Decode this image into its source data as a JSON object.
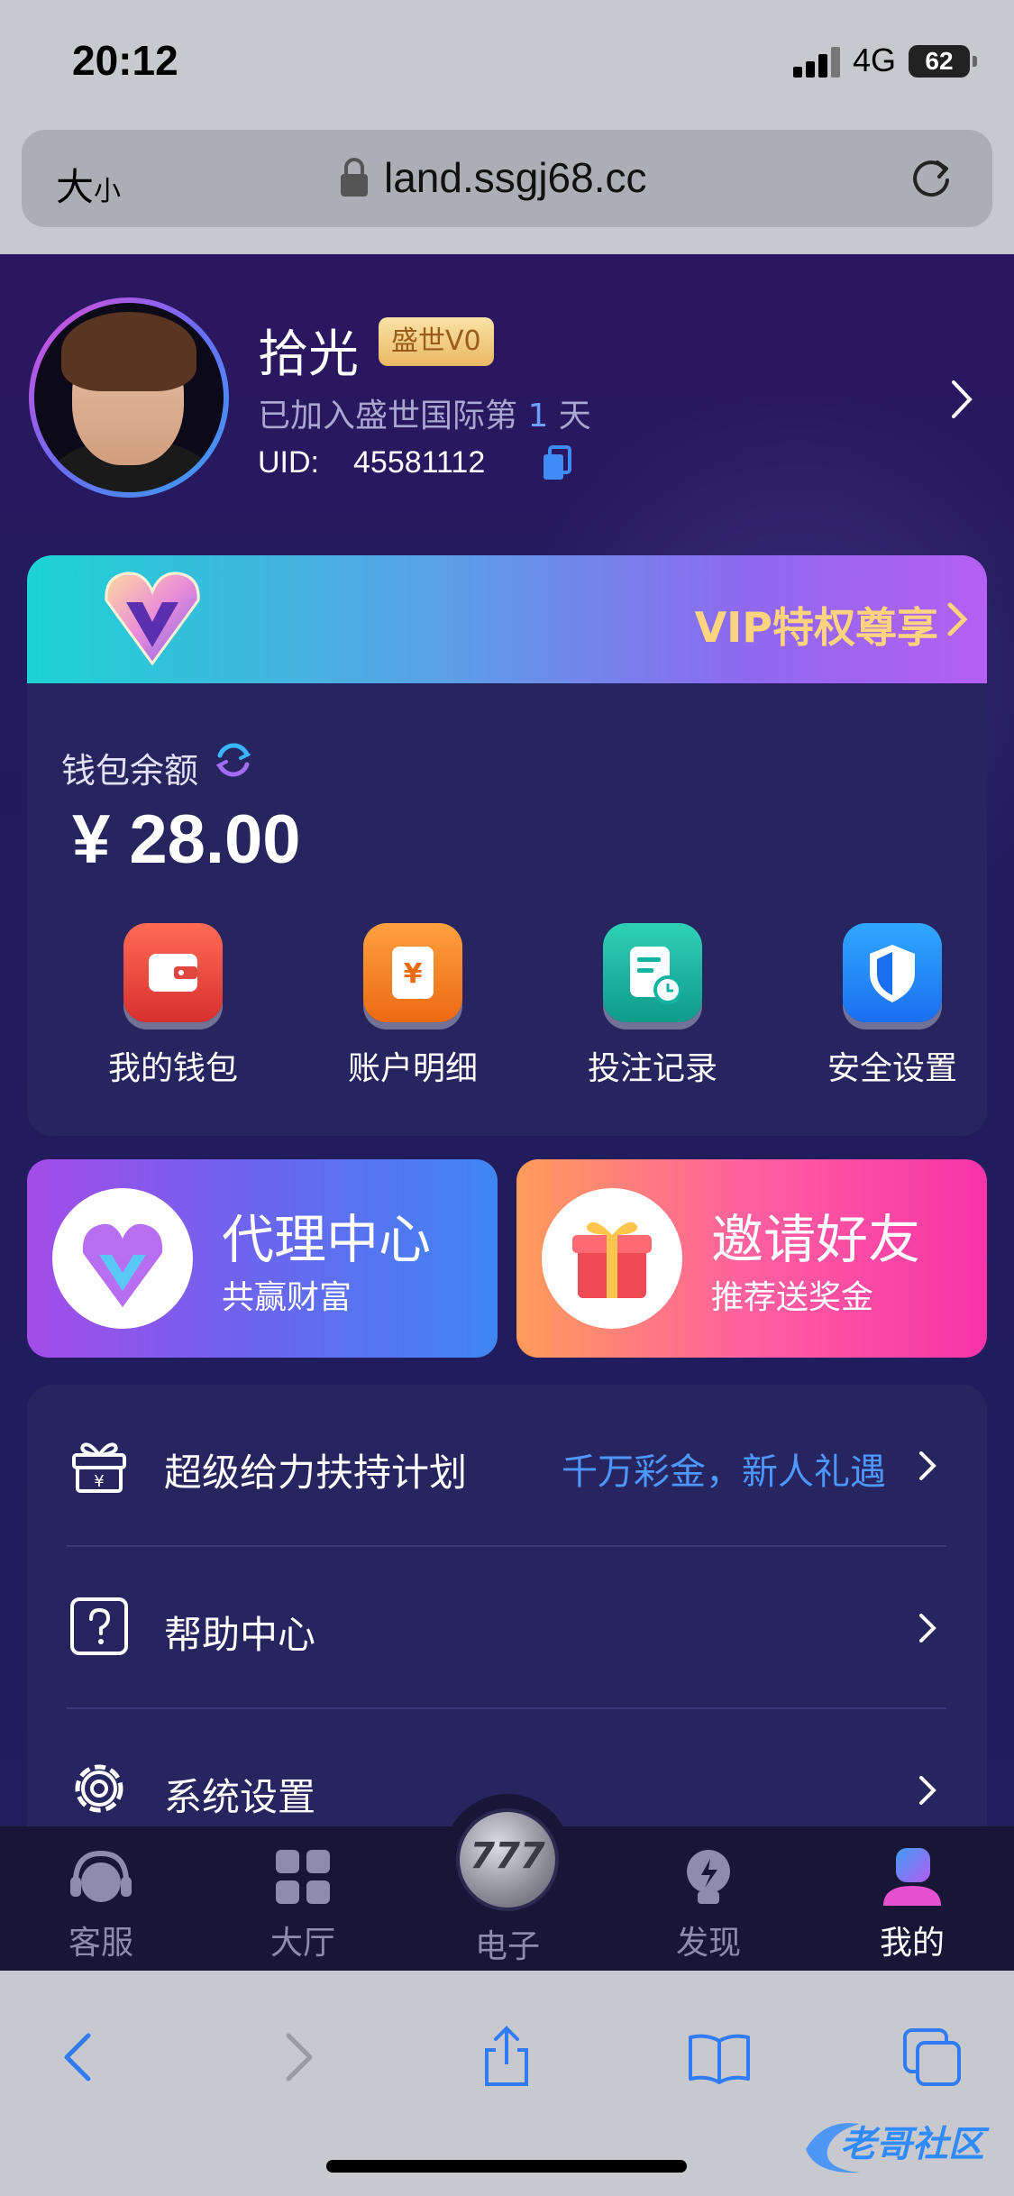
{
  "status_bar": {
    "time": "20:12",
    "network": "4G",
    "battery": "62"
  },
  "browser": {
    "text_size_label": "大",
    "text_size_small": "小",
    "url": "land.ssgj68.cc"
  },
  "profile": {
    "name": "拾光",
    "vip_badge": "盛世V0",
    "joined_prefix": "已加入盛世国际第 ",
    "joined_days": "1",
    "joined_suffix": " 天",
    "uid_label": "UID:",
    "uid_value": "45581112"
  },
  "vip_banner": {
    "text": "VIP特权尊享"
  },
  "wallet": {
    "label": "钱包余额",
    "balance": "¥ 28.00",
    "actions": [
      {
        "label": "我的钱包",
        "icon": "wallet-icon",
        "color": "#e8443c"
      },
      {
        "label": "账户明细",
        "icon": "ledger-icon",
        "color": "#f27a20"
      },
      {
        "label": "投注记录",
        "icon": "record-icon",
        "color": "#12b3a0"
      },
      {
        "label": "安全设置",
        "icon": "shield-icon",
        "color": "#2b8cf5"
      }
    ]
  },
  "promos": {
    "agent": {
      "title": "代理中心",
      "subtitle": "共赢财富"
    },
    "invite": {
      "title": "邀请好友",
      "subtitle": "推荐送奖金"
    }
  },
  "menu": [
    {
      "label": "超级给力扶持计划",
      "extra": "千万彩金，新人礼遇",
      "icon": "gift-icon"
    },
    {
      "label": "帮助中心",
      "extra": "",
      "icon": "help-icon"
    },
    {
      "label": "系统设置",
      "extra": "",
      "icon": "settings-icon"
    }
  ],
  "tabs": [
    {
      "label": "客服",
      "icon": "headset-icon"
    },
    {
      "label": "大厅",
      "icon": "grid-icon"
    },
    {
      "label": "电子",
      "icon": "slot-777-icon"
    },
    {
      "label": "发现",
      "icon": "lightbulb-icon"
    },
    {
      "label": "我的",
      "icon": "user-icon"
    }
  ],
  "center_coin": "777",
  "watermark": "老哥社区"
}
